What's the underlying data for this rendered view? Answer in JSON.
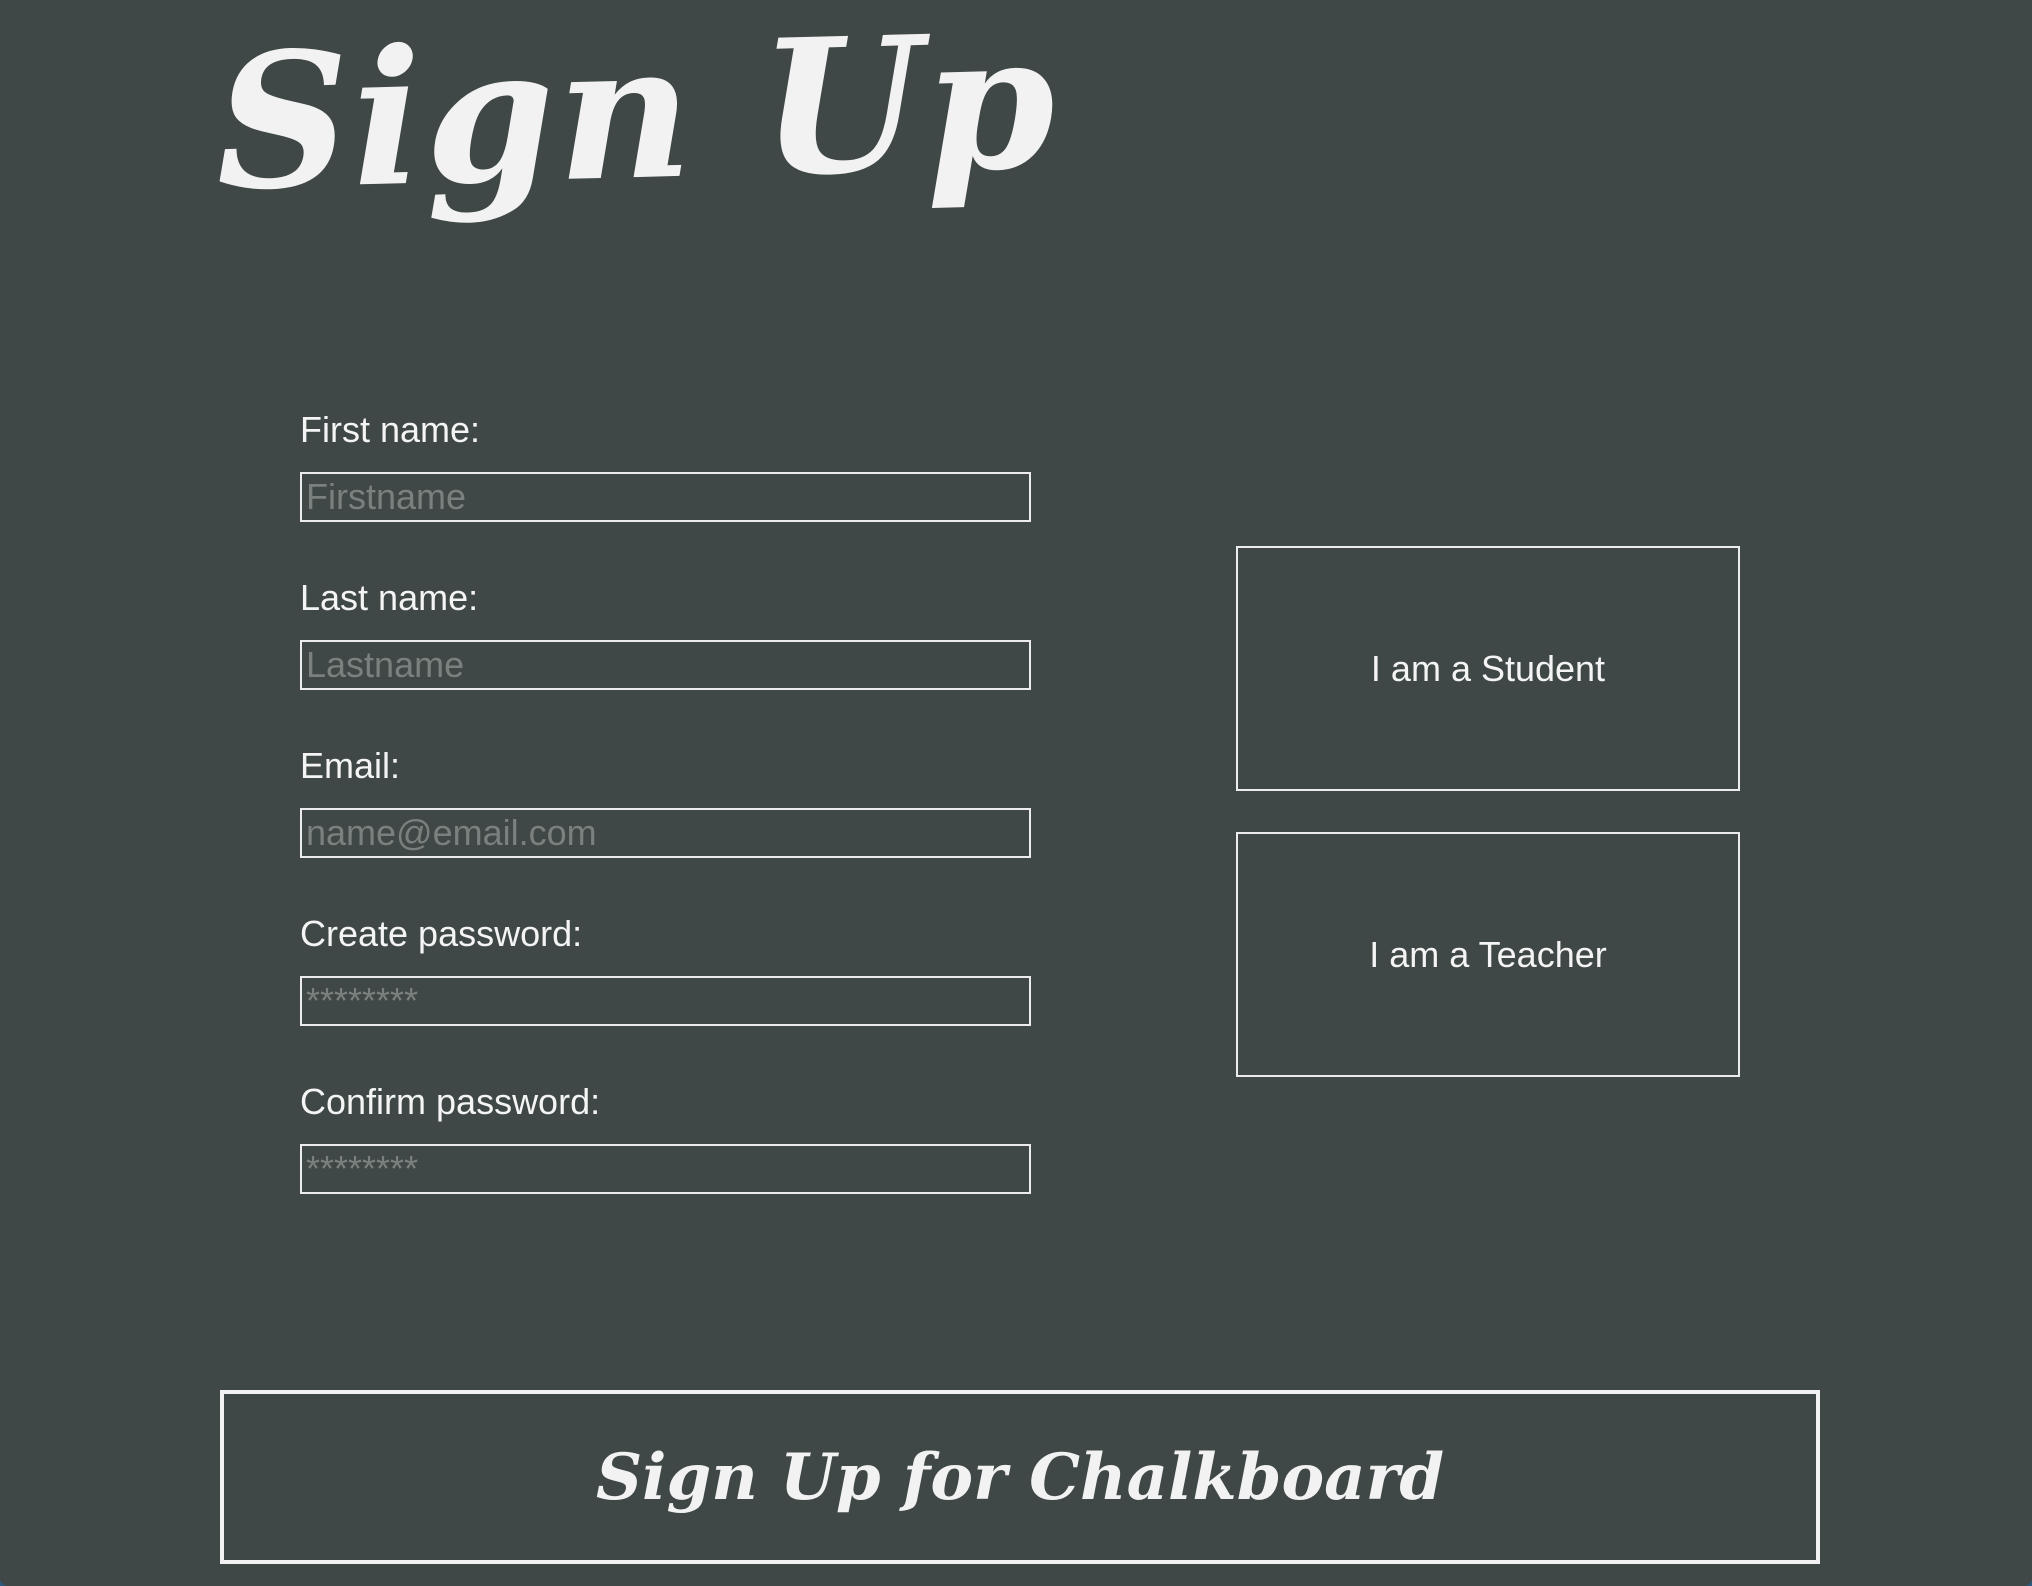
{
  "page": {
    "title": "Sign Up"
  },
  "form": {
    "fields": [
      {
        "label": "First name:",
        "placeholder": "Firstname",
        "value": ""
      },
      {
        "label": "Last name:",
        "placeholder": "Lastname",
        "value": ""
      },
      {
        "label": "Email:",
        "placeholder": "name@email.com",
        "value": ""
      },
      {
        "label": "Create password:",
        "placeholder": "********",
        "value": ""
      },
      {
        "label": "Confirm password:",
        "placeholder": "********",
        "value": ""
      }
    ]
  },
  "roles": {
    "student_label": "I am a Student",
    "teacher_label": "I am a Teacher"
  },
  "submit": {
    "label": "Sign Up for Chalkboard"
  },
  "colors": {
    "background": "#3f4846",
    "text": "#f4f4f4",
    "border": "#ececec",
    "placeholder": "#7a807e"
  }
}
